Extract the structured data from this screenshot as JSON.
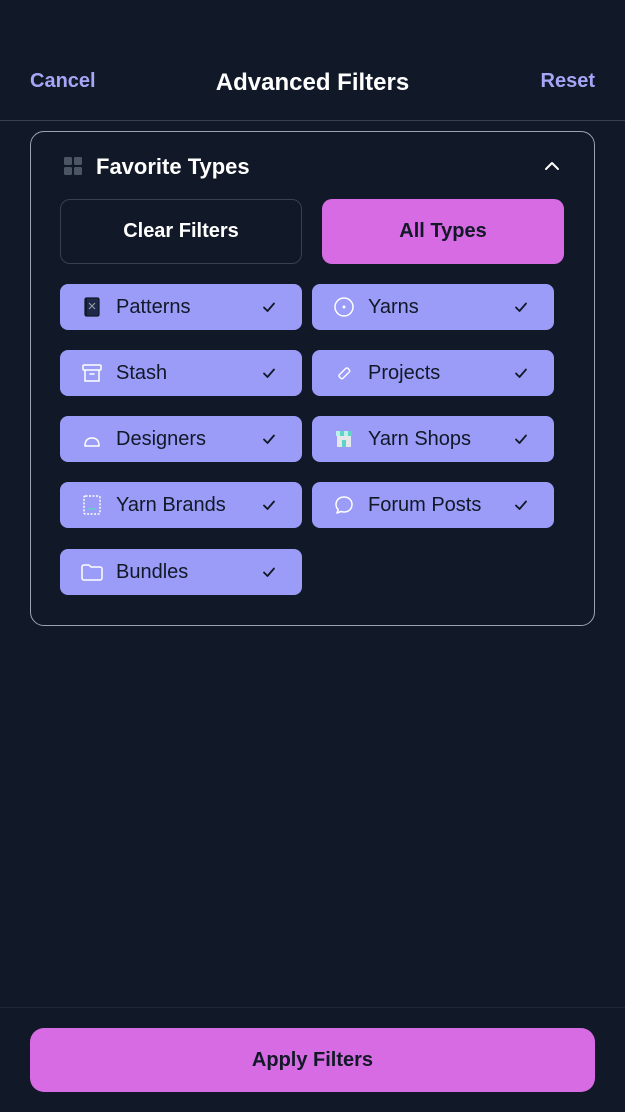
{
  "header": {
    "cancel_label": "Cancel",
    "title": "Advanced Filters",
    "reset_label": "Reset"
  },
  "section": {
    "title": "Favorite Types",
    "icon": "grid-icon",
    "clear_label": "Clear Filters",
    "all_label": "All Types",
    "chips": [
      {
        "label": "Patterns",
        "icon": "book-icon",
        "checked": true
      },
      {
        "label": "Yarns",
        "icon": "yarn-ball-icon",
        "checked": true
      },
      {
        "label": "Stash",
        "icon": "box-icon",
        "checked": true
      },
      {
        "label": "Projects",
        "icon": "needle-icon",
        "checked": true
      },
      {
        "label": "Designers",
        "icon": "person-icon",
        "checked": true
      },
      {
        "label": "Yarn Shops",
        "icon": "shop-icon",
        "checked": true
      },
      {
        "label": "Yarn Brands",
        "icon": "tag-frame-icon",
        "checked": true
      },
      {
        "label": "Forum Posts",
        "icon": "chat-bubble-icon",
        "checked": true
      },
      {
        "label": "Bundles",
        "icon": "folder-icon",
        "checked": true
      }
    ]
  },
  "footer": {
    "apply_label": "Apply Filters"
  },
  "colors": {
    "background": "#111827",
    "accent": "#d66be3",
    "chip": "#9b9cf7",
    "link": "#a5a6f6"
  }
}
